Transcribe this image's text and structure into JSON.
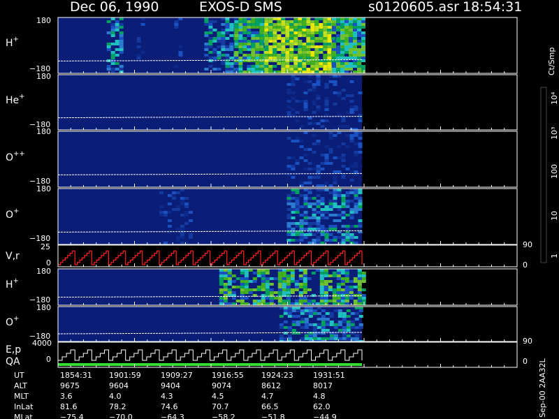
{
  "title": {
    "date": "Dec 06, 1990",
    "instrument": "EXOS-D SMS",
    "file": "s0120605.asr",
    "time": "18:54:31"
  },
  "colors": {
    "background": "#000000",
    "panel_background": "#0a1e78",
    "frame": "#ffffff",
    "stair_red": "#ff2020",
    "qa_green": "#33dd33"
  },
  "colorbar": {
    "unit": "Ct/Smp",
    "tick_labels": [
      "10⁴",
      "10³",
      "100",
      "10",
      "1"
    ],
    "tick_values": [
      10000,
      1000,
      100,
      10,
      1
    ],
    "colors": [
      "#ffffff",
      "#aa0000",
      "#ee2222",
      "#8a7a2a",
      "#9a8a20",
      "#c0c000",
      "#e8e800",
      "#90d020",
      "#40b020",
      "#00a060",
      "#20c0c0",
      "#1a50c0",
      "#0a1e78"
    ]
  },
  "footer_note": "Sep-00 2AA32L",
  "chart_data": [
    {
      "type": "heatmap",
      "panel": "H+",
      "label_main": "H",
      "label_sup": "+",
      "ylim": [
        -180,
        180
      ],
      "y_tick_labels": [
        "180",
        "−180"
      ],
      "x_time_range": [
        "18:54:31",
        "19:35:00"
      ],
      "activity": [
        {
          "start": "19:01:00",
          "end": "19:03:00",
          "level": "medium"
        },
        {
          "start": "19:05:00",
          "end": "19:06:00",
          "level": "low"
        },
        {
          "start": "19:10:00",
          "end": "19:11:00",
          "level": "low"
        },
        {
          "start": "19:14:00",
          "end": "19:18:00",
          "level": "medium"
        },
        {
          "start": "19:18:00",
          "end": "19:22:00",
          "level": "high"
        },
        {
          "start": "19:22:00",
          "end": "19:31:00",
          "level": "very high"
        },
        {
          "start": "19:31:00",
          "end": "19:35:00",
          "level": "high"
        }
      ]
    },
    {
      "type": "heatmap",
      "panel": "He+",
      "label_main": "He",
      "label_sup": "+",
      "ylim": [
        -180,
        180
      ],
      "y_tick_labels": [
        "180",
        "−180"
      ],
      "activity": [
        {
          "start": "19:25:00",
          "end": "19:35:00",
          "level": "low"
        }
      ]
    },
    {
      "type": "heatmap",
      "panel": "O++",
      "label_main": "O",
      "label_sup": "++",
      "ylim": [
        -180,
        180
      ],
      "y_tick_labels": [
        "180",
        "−180"
      ],
      "activity": [
        {
          "start": "19:25:00",
          "end": "19:35:00",
          "level": "low"
        }
      ]
    },
    {
      "type": "heatmap",
      "panel": "O+",
      "label_main": "O",
      "label_sup": "+",
      "ylim": [
        -180,
        180
      ],
      "y_tick_labels": [
        "180",
        "−180"
      ],
      "activity": [
        {
          "start": "19:08:00",
          "end": "19:12:00",
          "level": "low"
        },
        {
          "start": "19:25:00",
          "end": "19:35:00",
          "level": "medium"
        }
      ]
    },
    {
      "type": "line",
      "panel": "V,r",
      "label": "V,r",
      "ylim": [
        0,
        25
      ],
      "y_tick_labels": [
        "25",
        "0"
      ],
      "right_tick_labels": [
        "90",
        "0"
      ],
      "sweep_count": 18,
      "steps_per_sweep": 7
    },
    {
      "type": "heatmap",
      "panel": "H+ (2)",
      "label_main": "H",
      "label_sup": "+",
      "ylim": [
        -180,
        180
      ],
      "y_tick_labels": [
        "180",
        "−180"
      ],
      "activity": [
        {
          "start": "19:16:00",
          "end": "19:35:00",
          "level": "high",
          "pattern": "banded"
        }
      ]
    },
    {
      "type": "heatmap",
      "panel": "O+ (2)",
      "label_main": "O",
      "label_sup": "+",
      "ylim": [
        -180,
        180
      ],
      "y_tick_labels": [
        "180",
        "−180"
      ],
      "activity": [
        {
          "start": "19:24:00",
          "end": "19:35:00",
          "level": "medium"
        }
      ]
    },
    {
      "type": "line",
      "panel": "E,p QA",
      "label_1": "E,p",
      "label_2": "QA",
      "ylim": [
        0,
        4000
      ],
      "y_tick_labels": [
        "4000",
        "0"
      ],
      "right_tick_labels": [
        "90",
        "0"
      ],
      "sweep_count": 18,
      "steps_per_sweep": 4
    },
    {
      "type": "table",
      "rows": [
        {
          "name": "UT",
          "values": [
            "1854:31",
            "1901:59",
            "1909:27",
            "1916:55",
            "1924:23",
            "1931:51"
          ]
        },
        {
          "name": "ALT",
          "values": [
            "9675",
            "9604",
            "9404",
            "9074",
            "8612",
            "8017"
          ]
        },
        {
          "name": "MLT",
          "values": [
            "3.6",
            "4.0",
            "4.3",
            "4.5",
            "4.7",
            "4.8"
          ]
        },
        {
          "name": "InLat",
          "values": [
            "81.6",
            "78.2",
            "74.6",
            "70.7",
            "66.5",
            "62.0"
          ]
        },
        {
          "name": "MLat",
          "values": [
            "−75.4",
            "−70.0",
            "−64.3",
            "−58.2",
            "−51.8",
            "−44.9"
          ]
        }
      ]
    }
  ]
}
